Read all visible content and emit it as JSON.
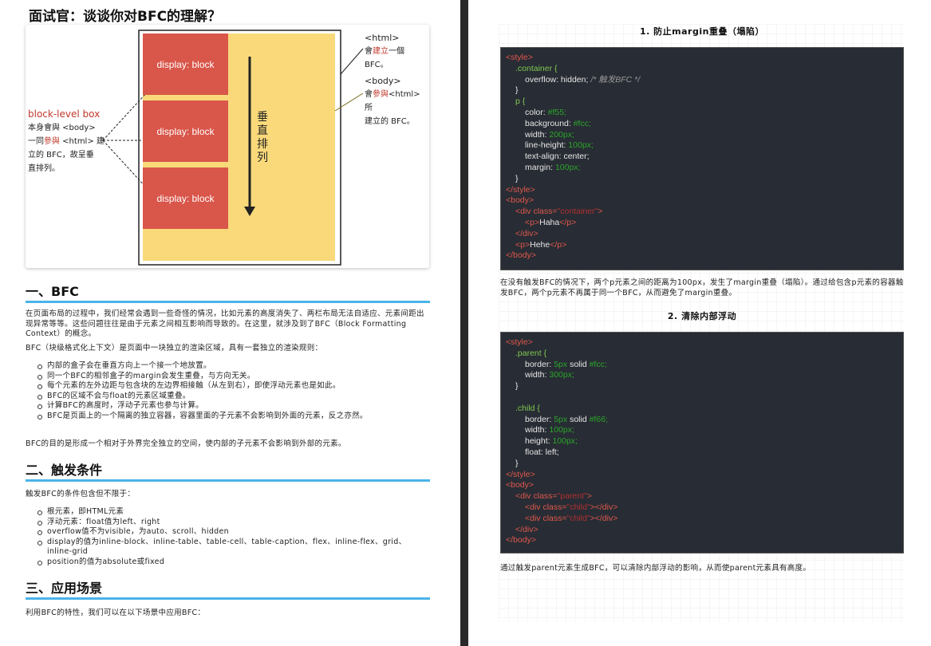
{
  "left": {
    "title": "面试官：谈谈你对BFC的理解？",
    "figure": {
      "block_label": "display: block",
      "html_tag": "<html>",
      "html_desc_1": "會",
      "html_desc_red": "建立",
      "html_desc_2": "一個 BFC。",
      "body_tag": "<body>",
      "body_desc_1": "會",
      "body_desc_red": "參與",
      "body_desc_2": "<html> 所",
      "body_desc_3": "建立的 BFC。",
      "block_heading": "block-level box",
      "block_desc_1": "本身會與 <body>",
      "block_desc_2a": "一同",
      "block_desc_2red": "參與",
      "block_desc_2b": " <html> 建",
      "block_desc_3": "立的 BFC，故呈垂",
      "block_desc_4": "直排列。",
      "vertical_label": "垂直排列"
    },
    "section1": {
      "heading": "一、BFC",
      "p1": "在页面布局的过程中，我们经常会遇到一些奇怪的情况，比如元素的高度消失了、两栏布局无法自适应、元素间距出现异常等等。这些问题往往是由于元素之间相互影响而导致的。在这里，就涉及到了BFC（Block Formatting Context）的概念。",
      "p2": "BFC（块级格式化上下文）是页面中一块独立的渲染区域，具有一套独立的渲染规则：",
      "items": [
        "内部的盒子会在垂直方向上一个接一个地放置。",
        "同一个BFC的相邻盒子的margin会发生重叠，与方向无关。",
        "每个元素的左外边距与包含块的左边界相接触（从左到右），即使浮动元素也是如此。",
        "BFC的区域不会与float的元素区域重叠。",
        "计算BFC的高度时，浮动子元素也参与计算。",
        "BFC是页面上的一个隔离的独立容器，容器里面的子元素不会影响到外面的元素，反之亦然。"
      ],
      "p3": "BFC的目的是形成一个相对于外界完全独立的空间，使内部的子元素不会影响到外部的元素。"
    },
    "section2": {
      "heading": "二、触发条件",
      "p1": "触发BFC的条件包含但不限于：",
      "items": [
        "根元素，即HTML元素",
        "浮动元素：float值为left、right",
        "overflow值不为visible，为auto、scroll、hidden",
        "display的值为inline-block、inline-table、table-cell、table-caption、flex、inline-flex、grid、inline-grid",
        "position的值为absolute或fixed"
      ]
    },
    "section3": {
      "heading": "三、应用场景",
      "p1": "利用BFC的特性，我们可以在以下场景中应用BFC："
    }
  },
  "right": {
    "title1": "1. 防止margin重叠（塌陷）",
    "code1": {
      "l1": "<style>",
      "l2": ".container {",
      "l3a": "overflow: hidden;",
      "l3b": "/* 触发BFC */",
      "l4": "}",
      "l5": "p {",
      "l6a": "color:",
      "l6b": "#f55;",
      "l7a": "background:",
      "l7b": "#fcc;",
      "l8a": "width:",
      "l8b": "200px;",
      "l9a": "line-height:",
      "l9b": "100px;",
      "l10": "text-align: center;",
      "l11a": "margin:",
      "l11b": "100px;",
      "l12": "}",
      "l13": "</style>",
      "l14": "<body>",
      "l15a": "<div class=",
      "l15b": "\"container\"",
      "l15c": ">",
      "l16a": "<p>",
      "l16b": "Haha",
      "l16c": "</p>",
      "l17": "</div>",
      "l18a": "<p>",
      "l18b": "Hehe",
      "l18c": "</p>",
      "l19": "</body>"
    },
    "para1": "在没有触发BFC的情况下，两个p元素之间的距离为100px，发生了margin重叠（塌陷）。通过给包含p元素的容器触发BFC，两个p元素不再属于同一个BFC，从而避免了margin重叠。",
    "title2": "2. 清除内部浮动",
    "code2": {
      "l1": "<style>",
      "l2": ".parent {",
      "l3a": "border:",
      "l3b": "5px",
      "l3c": "solid",
      "l3d": "#fcc;",
      "l4a": "width:",
      "l4b": "300px;",
      "l5": "}",
      "l6": "",
      "l7": ".child {",
      "l8a": "border:",
      "l8b": "5px",
      "l8c": "solid",
      "l8d": "#f66;",
      "l9a": "width:",
      "l9b": "100px;",
      "l10a": "height:",
      "l10b": "100px;",
      "l11": "float: left;",
      "l12": "}",
      "l13": "</style>",
      "l14": "<body>",
      "l15a": "<div class=",
      "l15b": "\"parent\"",
      "l15c": ">",
      "l16a": "<div class=",
      "l16b": "\"child\"",
      "l16c": "></div>",
      "l17a": "<div class=",
      "l17b": "\"child\"",
      "l17c": "></div>",
      "l18": "</div>",
      "l19": "</body>"
    },
    "para2": "通过触发parent元素生成BFC，可以清除内部浮动的影响，从而使parent元素具有高度。"
  }
}
